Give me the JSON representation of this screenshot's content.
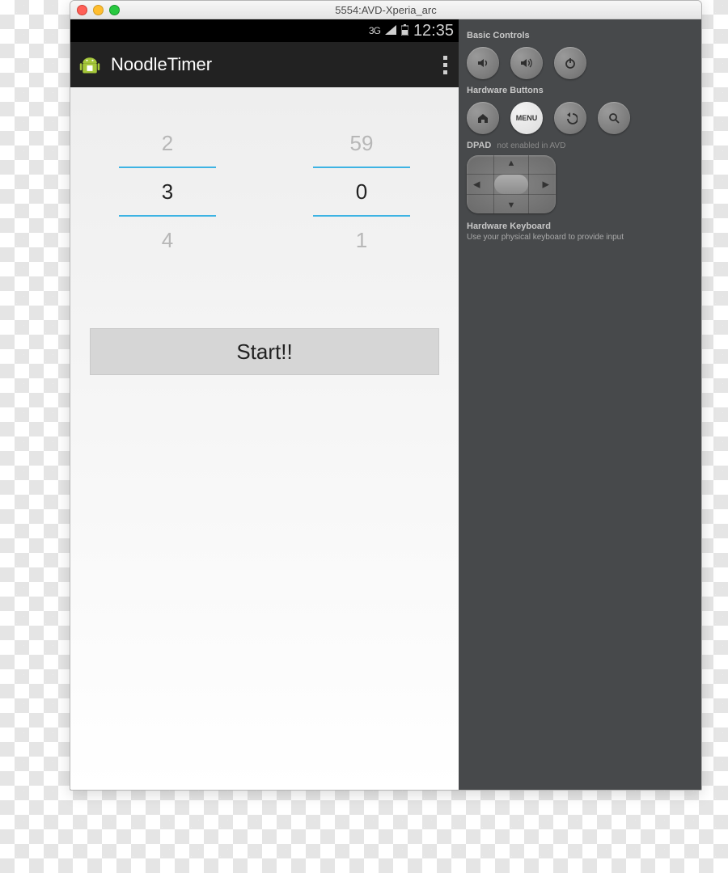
{
  "window": {
    "title": "5554:AVD-Xperia_arc"
  },
  "statusbar": {
    "network": "3G",
    "time": "12:35"
  },
  "actionbar": {
    "title": "NoodleTimer"
  },
  "picker": {
    "minutes": {
      "prev": "2",
      "current": "3",
      "next": "4"
    },
    "seconds": {
      "prev": "59",
      "current": "0",
      "next": "1"
    }
  },
  "start_label": "Start!!",
  "side": {
    "basic_controls": "Basic Controls",
    "hardware_buttons": "Hardware Buttons",
    "menu": "MENU",
    "dpad_label": "DPAD",
    "dpad_status": "not enabled in AVD",
    "hk_title": "Hardware Keyboard",
    "hk_sub": "Use your physical keyboard to provide input"
  }
}
